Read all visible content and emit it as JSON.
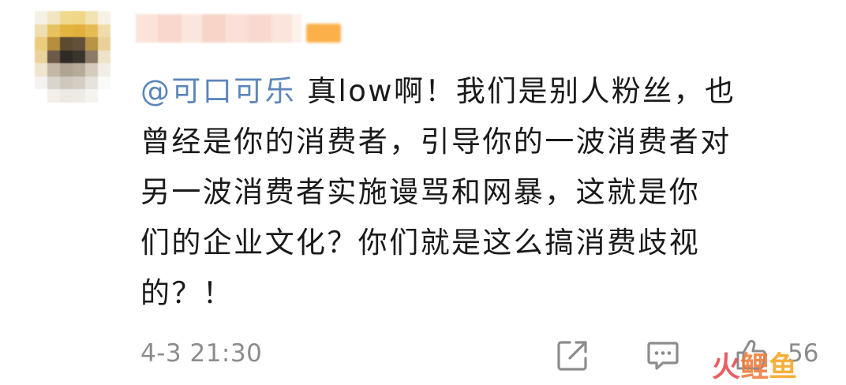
{
  "comment": {
    "mention": "@可口可乐",
    "lines": [
      " 真low啊！我们是别人粉丝，也",
      "曾经是你的消费者，引导你的一波消费者对",
      "另一波消费者实施谩骂和网暴，这就是你",
      "们的企业文化？你们就是这么搞消费歧视",
      "的？！"
    ]
  },
  "meta": {
    "timestamp": "4-3 21:30",
    "like_count": "56"
  },
  "actions": {
    "share_icon": "share-icon",
    "reply_icon": "comment-icon",
    "like_icon": "thumbs-up-icon"
  },
  "watermark": {
    "chars": [
      "火",
      "鲤",
      "鱼"
    ]
  },
  "colors": {
    "mention": "#5b86b8",
    "text": "#1a1a1a",
    "meta": "#8c8c8c",
    "icon": "#8c8c8c",
    "badge": "#fbb04a"
  }
}
